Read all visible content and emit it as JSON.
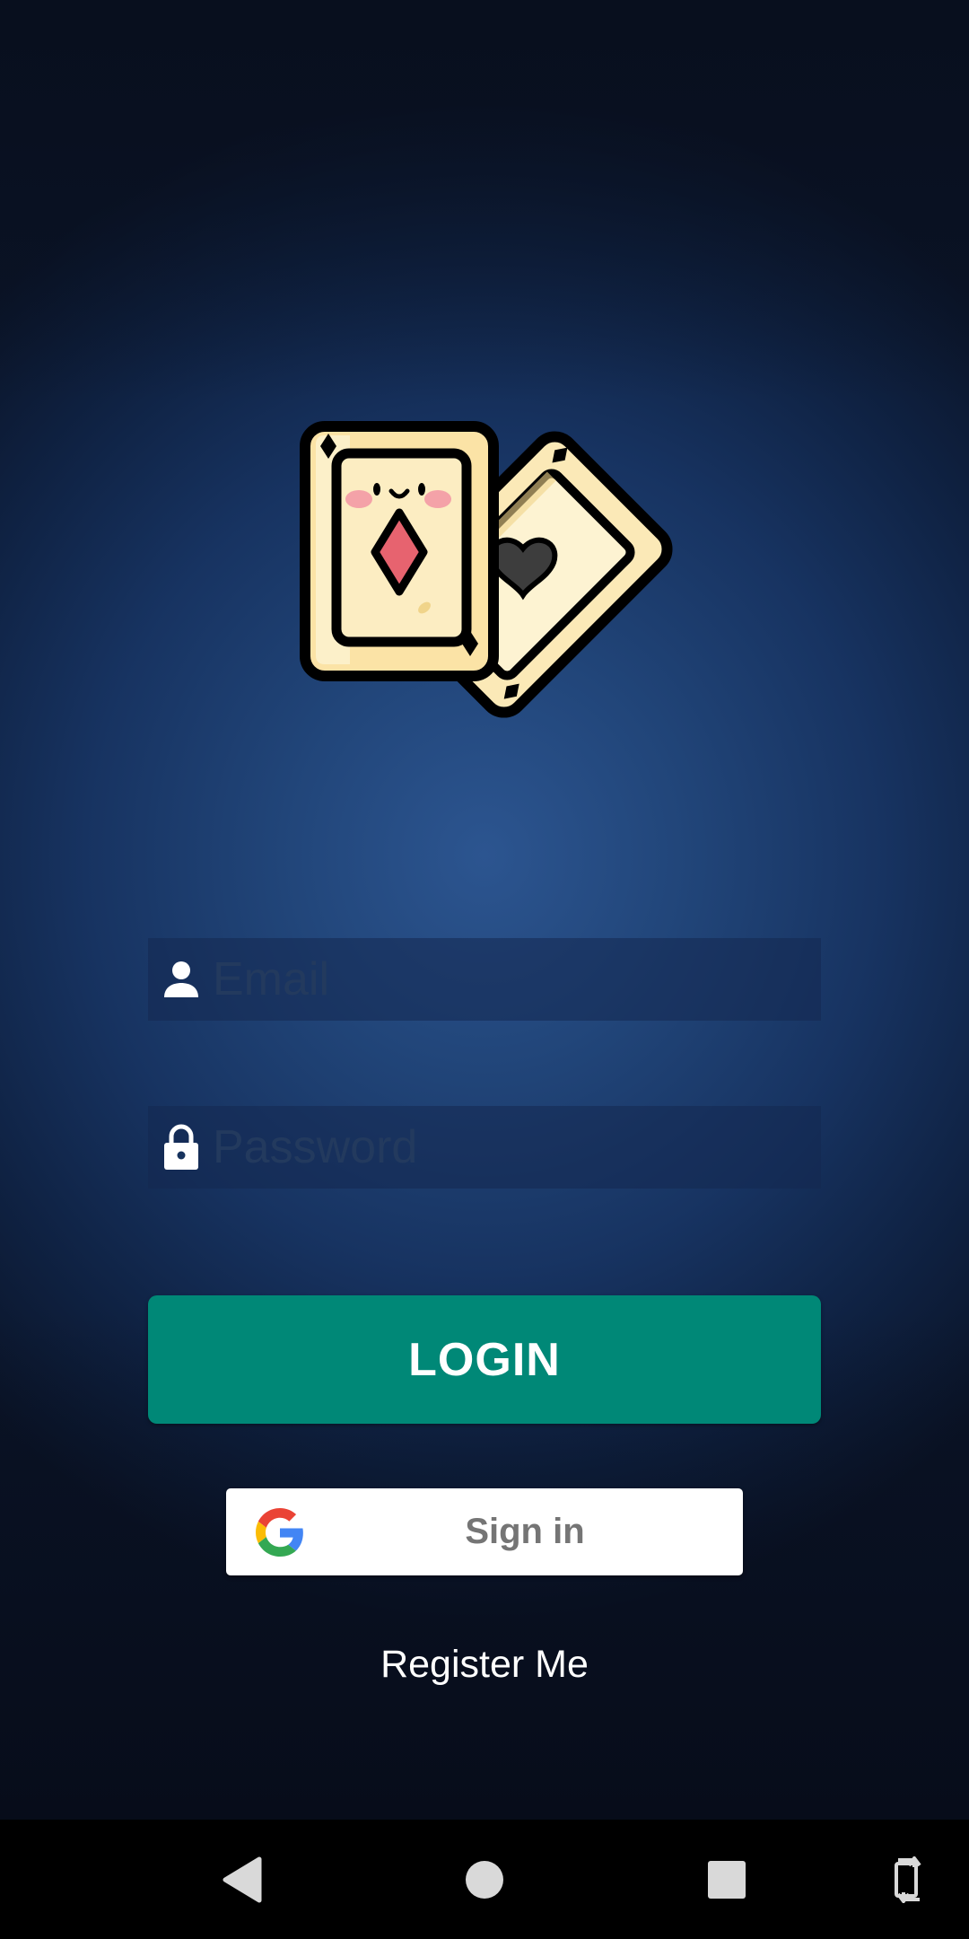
{
  "login_form": {
    "email_placeholder": "Email",
    "password_placeholder": "Password",
    "login_label": "LOGIN",
    "google_signin_label": "Sign in",
    "register_label": "Register Me"
  },
  "icons": {
    "logo": "playing-cards-icon",
    "email": "person-icon",
    "password": "lock-icon",
    "google": "google-g-icon",
    "nav": [
      "back-icon",
      "home-icon",
      "recents-icon",
      "rotate-icon"
    ]
  },
  "colors": {
    "background_center": "#2c5590",
    "background_edge": "#0a1326",
    "login_button": "#008877",
    "field_background": "#14284f",
    "placeholder": "#233a5e",
    "text_white": "#ffffff",
    "google_label": "#757575"
  }
}
